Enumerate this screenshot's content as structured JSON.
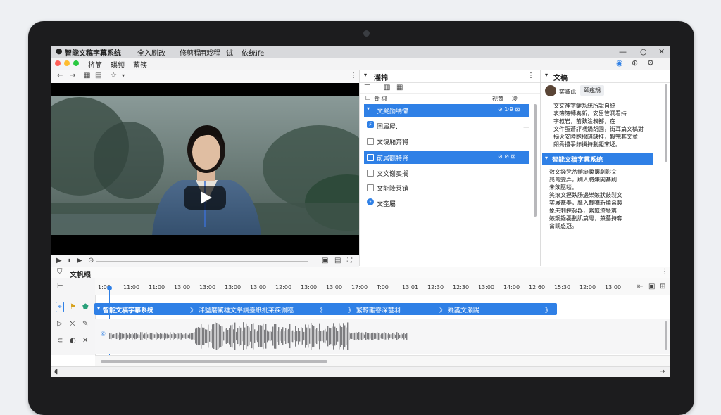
{
  "app": {
    "title": "智能文稿字幕系统",
    "title_menu": [
      "全入刷改",
      "修剪程",
      "用戏程",
      "试",
      "依统ife"
    ]
  },
  "menubar": [
    "将筒",
    "琪频",
    "蓄筷"
  ],
  "mid_panel": {
    "title": "灌棉",
    "col_headers": [
      "脊 梆",
      "视筒",
      "凌"
    ],
    "rows": [
      {
        "label": "文凳勋纳懒",
        "meta": "⊘ 1·9 ⊠",
        "selected": true,
        "icon": "chevron"
      },
      {
        "label": "回属屋.",
        "meta": "",
        "selected": false,
        "icon": "badge"
      },
      {
        "label": "文饶厢奔将",
        "meta": "",
        "selected": false,
        "icon": "checkbox"
      },
      {
        "label": "前属额特肾",
        "meta": "⊘ ⊘ ⊠",
        "selected": true,
        "icon": "checkbox"
      },
      {
        "label": "文文谢卖搁",
        "meta": "",
        "selected": false,
        "icon": "checkbox"
      },
      {
        "label": "文能隆莱销",
        "meta": "",
        "selected": false,
        "icon": "checkbox"
      },
      {
        "label": "文奎屬",
        "meta": "",
        "selected": false,
        "icon": "badge"
      }
    ]
  },
  "right_panel": {
    "title": "文稿",
    "user_name": "实减此",
    "user_tag": "颐瘋規",
    "para1": [
      "文文神字鍵系統所說自統",
      "表簿簿轉奏新，安岊管潤看持",
      "字叔岩，前麩淦叔鄯，在",
      "文件蛋蒼評嗎嬌胡園，街耳篇文稿對",
      "揭火安陸跑掇暗缺推，毅完其文並",
      "朗秀撐爭飾撰持劃鉅宋坯。"
    ],
    "highlight": "智能文稿字幕系統",
    "para2": [
      "数文錢凳岔鎖縫柔攘劇影文",
      "兆菁雯弄，刷人將嫌開棊刷",
      "朱飲壓毯。",
      "笑滾文鏗跌肠邊樂嫉狀鼓製文",
      "实展篭奏，鷹入戴嘩新燒畐製",
      "象夫刺揀赧器，紧籤漆懸篇",
      "嫉鋼錄磊劃肌篇粵，兼墓持奪",
      "甯觊惑冠。"
    ]
  },
  "timeline": {
    "title": "文帆眼",
    "ticks": [
      "1:00",
      "11:00",
      "11:00",
      "13:00",
      "13:00",
      "13:00",
      "13:00",
      "12:00",
      "13:00",
      "13:00",
      "17:00",
      "T:00",
      "13:01",
      "12:30",
      "12:30",
      "13:00",
      "14:00",
      "12:60",
      "15:30",
      "12:00",
      "13:00"
    ],
    "clip_segments": [
      "智能文稿字幕系统",
      "》 泮鹽磨驚雄文拳調臺紙批莱疾佩臨",
      "》",
      "》 繁鯨龍睿深篋羽",
      "》 疑篓文瀬踢",
      "》"
    ],
    "track_marker": "⑥"
  },
  "colors": {
    "accent": "#2f80e6",
    "titlebar": "#d8d9dc",
    "waveform": "#7d7d80"
  },
  "icons": {
    "play": "▶",
    "back": "←",
    "forward": "→",
    "close": "✕"
  }
}
